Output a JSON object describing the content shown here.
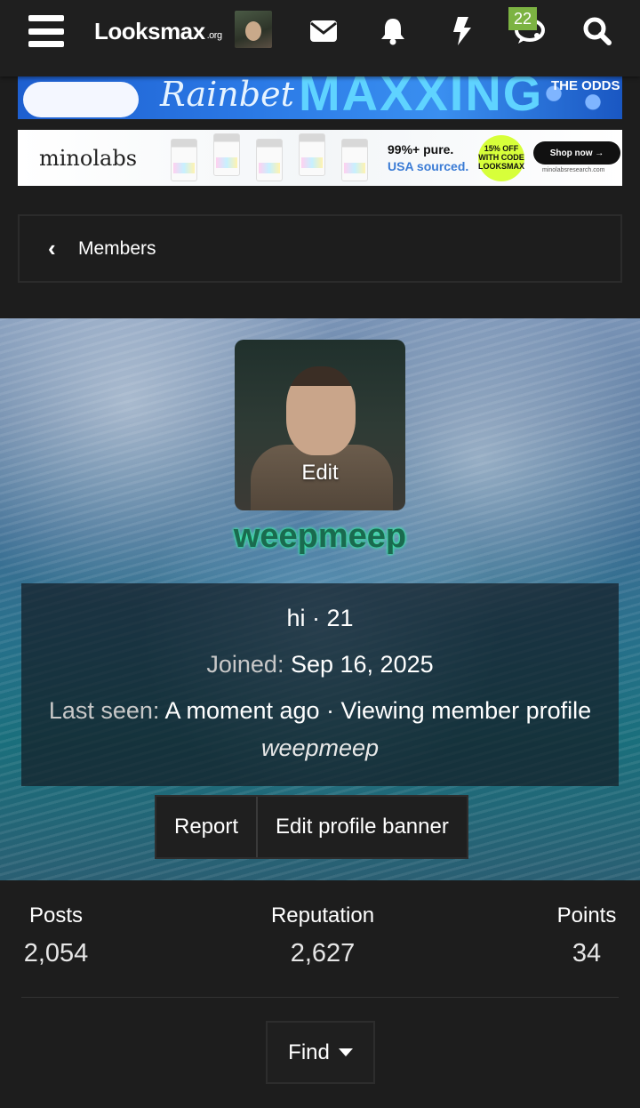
{
  "topbar": {
    "logo_text": "Looksmax",
    "logo_suffix": ".org",
    "notification_badge": "22",
    "icons": [
      "menu-icon",
      "envelope-icon",
      "bell-icon",
      "bolt-icon",
      "chat-icon",
      "search-icon"
    ]
  },
  "ads": {
    "ad1": {
      "brand": "Rainbet",
      "headline": "MAXXING",
      "tag": "THE ODDS"
    },
    "ad2": {
      "brand": "minolabs",
      "vials": [
        "GLP-3",
        "BPC-157",
        "GHK-CU"
      ],
      "pure": "99%+ pure.",
      "sourced": "USA sourced.",
      "discount": "15% OFF WITH CODE LOOKSMAX",
      "cta": "Shop now →",
      "site": "minolabsresearch.com"
    }
  },
  "breadcrumb": {
    "label": "Members"
  },
  "profile": {
    "avatar_edit_label": "Edit",
    "username": "weepmeep",
    "line1": "hi · 21",
    "joined_label": "Joined:",
    "joined_value": "Sep 16, 2025",
    "last_seen_label": "Last seen:",
    "last_seen_value": "A moment ago · Viewing member profile",
    "last_seen_target": "weepmeep"
  },
  "actions": {
    "report": "Report",
    "edit_banner": "Edit profile banner"
  },
  "stats": [
    {
      "label": "Posts",
      "value": "2,054"
    },
    {
      "label": "Reputation",
      "value": "2,627"
    },
    {
      "label": "Points",
      "value": "34"
    }
  ],
  "find_label": "Find",
  "colors": {
    "username_glow": "#39ffb0",
    "badge": "#7cb342",
    "background": "#1d1d1d"
  }
}
